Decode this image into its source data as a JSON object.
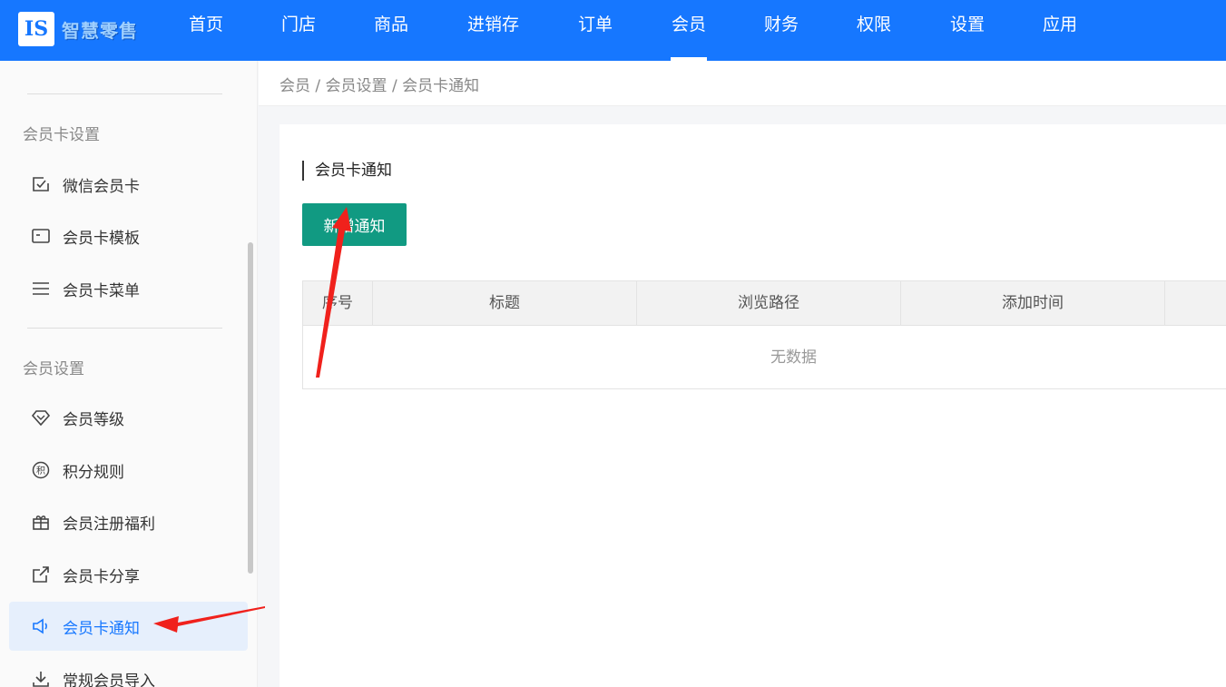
{
  "app": {
    "logo_text": "智慧零售",
    "logo_mark": "IS"
  },
  "nav": {
    "items": [
      {
        "label": "首页"
      },
      {
        "label": "门店"
      },
      {
        "label": "商品"
      },
      {
        "label": "进销存"
      },
      {
        "label": "订单"
      },
      {
        "label": "会员"
      },
      {
        "label": "财务"
      },
      {
        "label": "权限"
      },
      {
        "label": "设置"
      },
      {
        "label": "应用"
      }
    ],
    "active": "会员"
  },
  "sidebar": {
    "group1": "会员卡设置",
    "group2": "会员设置",
    "items": [
      {
        "label": "微信会员卡",
        "icon": "check-square-icon"
      },
      {
        "label": "会员卡模板",
        "icon": "card-icon"
      },
      {
        "label": "会员卡菜单",
        "icon": "menu-icon"
      },
      {
        "label": "会员等级",
        "icon": "diamond-icon"
      },
      {
        "label": "积分规则",
        "icon": "points-icon"
      },
      {
        "label": "会员注册福利",
        "icon": "gift-icon"
      },
      {
        "label": "会员卡分享",
        "icon": "share-icon"
      },
      {
        "label": "会员卡通知",
        "icon": "speaker-icon"
      },
      {
        "label": "常规会员导入",
        "icon": "download-icon"
      }
    ],
    "active": "会员卡通知"
  },
  "breadcrumb": "会员 / 会员设置 / 会员卡通知",
  "content": {
    "section_title": "会员卡通知",
    "add_button": "新增通知",
    "table": {
      "columns": [
        "序号",
        "标题",
        "浏览路径",
        "添加时间"
      ],
      "empty_text": "无数据"
    }
  },
  "colors": {
    "brand": "#1677ff",
    "button": "#119a82",
    "arrow": "#f0211c"
  }
}
